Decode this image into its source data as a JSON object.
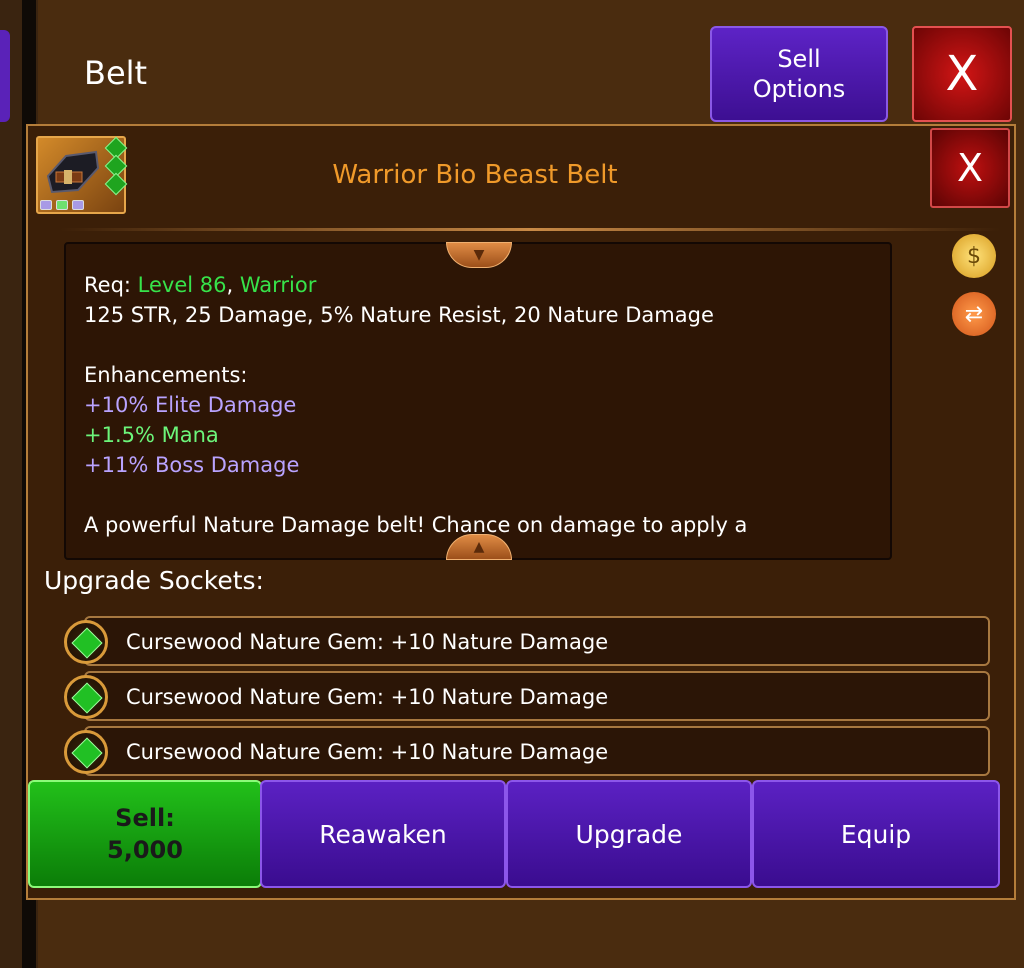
{
  "header": {
    "title": "Belt",
    "sell_options_label": "Sell\nOptions",
    "close_label": "X"
  },
  "item": {
    "name": "Warrior Bio Beast Belt",
    "close_label": "X",
    "req_prefix": "Req: ",
    "req_level": "Level 86",
    "req_sep": ", ",
    "req_class": "Warrior",
    "stats": "125 STR, 25 Damage, 5% Nature Resist, 20 Nature Damage",
    "enhancements_title": "Enhancements:",
    "enhancements": [
      "+10% Elite Damage",
      "+1.5% Mana",
      "+11% Boss Damage"
    ],
    "description": "A powerful Nature Damage belt! Chance on damage to apply a"
  },
  "sockets": {
    "title": "Upgrade Sockets:",
    "items": [
      "Cursewood Nature Gem: +10 Nature Damage",
      "Cursewood Nature Gem: +10 Nature Damage",
      "Cursewood Nature Gem: +10 Nature Damage"
    ]
  },
  "actions": {
    "sell": "Sell:\n5,000",
    "reawaken": "Reawaken",
    "upgrade": "Upgrade",
    "equip": "Equip"
  },
  "colors": {
    "background": "#4a2c0f",
    "title_orange": "#f09a2a",
    "req_green": "#37e34a",
    "purple_button": "#4a17a8",
    "green_button": "#18a314",
    "red_close": "#b00d0d"
  }
}
